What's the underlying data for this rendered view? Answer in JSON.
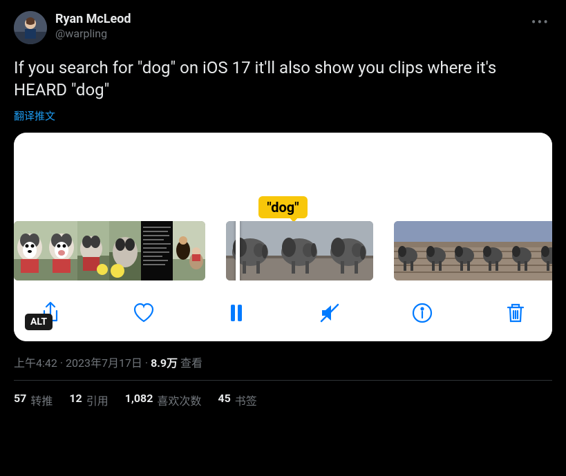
{
  "author": {
    "display_name": "Ryan McLeod",
    "handle": "@warpling"
  },
  "tweet_text": "If you search for \"dog\" on iOS 17 it'll also show you clips where it's HEARD \"dog\"",
  "translate_label": "翻译推文",
  "media": {
    "tooltip_text": "\"dog\"",
    "alt_badge": "ALT"
  },
  "meta": {
    "time": "上午4:42",
    "dot1": " · ",
    "date": "2023年7月17日",
    "dot2": " · ",
    "views_count": "8.9万",
    "views_label": " 查看"
  },
  "stats": {
    "retweets_count": "57",
    "retweets_label": "转推",
    "quotes_count": "12",
    "quotes_label": "引用",
    "likes_count": "1,082",
    "likes_label": "喜欢次数",
    "bookmarks_count": "45",
    "bookmarks_label": "书签"
  }
}
